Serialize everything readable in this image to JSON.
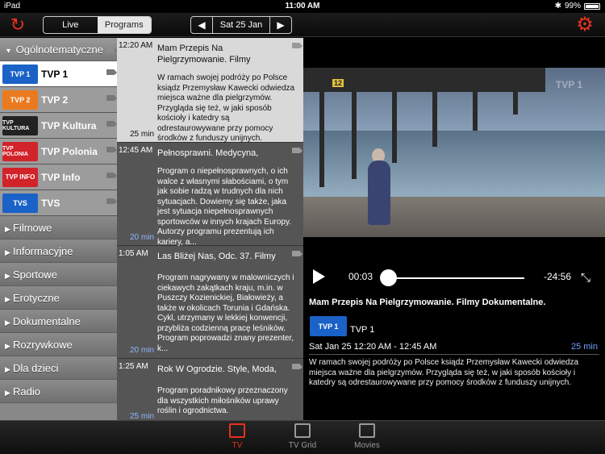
{
  "statusbar": {
    "carrier": "iPad",
    "time": "11:00 AM",
    "battery": "99%"
  },
  "toolbar": {
    "segments": [
      "Live",
      "Programs"
    ],
    "active_segment": "Programs",
    "date": "Sat 25 Jan"
  },
  "sidebar": {
    "open_category": "Ogólnotematyczne",
    "channels": [
      {
        "name": "TVP 1",
        "logo": "TVP 1",
        "logo_color": "#1a62c7"
      },
      {
        "name": "TVP 2",
        "logo": "TVP 2",
        "logo_color": "#ea7a1f"
      },
      {
        "name": "TVP Kultura",
        "logo": "TVP KULTURA",
        "logo_color": "#222222"
      },
      {
        "name": "TVP Polonia",
        "logo": "TVP POLONIA",
        "logo_color": "#d2232a"
      },
      {
        "name": "TVP Info",
        "logo": "TVP INFO",
        "logo_color": "#d2232a"
      },
      {
        "name": "TVS",
        "logo": "TVS",
        "logo_color": "#1a62c7"
      }
    ],
    "categories": [
      "Filmowe",
      "Informacyjne",
      "Sportowe",
      "Erotyczne",
      "Dokumentalne",
      "Rozrywkowe",
      "Dla dzieci",
      "Radio"
    ]
  },
  "programs": [
    {
      "time": "12:20 AM",
      "title": "Mam Przepis Na Pielgrzymowanie. Filmy",
      "desc": "W ramach swojej podróży po Polsce ksiądz Przemysław Kawecki odwiedza miejsca ważne dla pielgrzymów. Przygląda się też, w jaki sposób kościoły i katedry są odrestaurowywane przy pomocy środków z funduszy unijnych.",
      "duration": "25 min"
    },
    {
      "time": "12:45 AM",
      "title": "Pełnosprawni. Medycyna,",
      "desc": "Program o niepełnosprawnych, o ich walce z własnymi słabościami, o tym jak sobie radzą w trudnych dla nich sytuacjach. Dowiemy się także, jaka jest sytuacja niepełnosprawnych sportowców w innych krajach Europy. Autorzy programu prezentują ich kariery, a...",
      "duration": "20 min"
    },
    {
      "time": "1:05 AM",
      "title": "Las Bliżej Nas, Odc. 37. Filmy",
      "desc": "Program nagrywany w malowniczych i ciekawych zakątkach kraju, m.in. w Puszczy Kozienickiej, Białowieży, a także w okolicach Torunia i Gdańska. Cykl, utrzymany w lekkiej konwencji, przybliża codzienną pracę leśników. Program poprowadzi znany prezenter, k...",
      "duration": "20 min"
    },
    {
      "time": "1:25 AM",
      "title": "Rok W Ogrodzie. Style, Moda,",
      "desc": "Program poradnikowy przeznaczony dla wszystkich miłośników uprawy roślin i ogrodnictwa.",
      "duration": "25 min"
    }
  ],
  "video": {
    "age_rating": "12",
    "watermark": "TVP 1"
  },
  "player": {
    "current": "00:03",
    "remaining": "-24:56",
    "progress": 0.0
  },
  "info": {
    "title": "Mam Przepis Na Pielgrzymowanie. Filmy Dokumentalne.",
    "channel": "TVP 1",
    "logo": "TVP 1",
    "time": "Sat Jan 25 12:20 AM - 12:45 AM",
    "duration": "25 min",
    "desc": "W ramach swojej podróży po Polsce ksiądz Przemysław Kawecki odwiedza miejsca ważne dla pielgrzymów. Przygląda się też, w jaki sposób kościoły i katedry są odrestaurowywane przy pomocy środków z funduszy unijnych."
  },
  "tabs": [
    "TV",
    "TV Grid",
    "Movies"
  ],
  "active_tab": "TV",
  "colors": {
    "accent": "#e8321d",
    "link": "#6fa1ff"
  }
}
